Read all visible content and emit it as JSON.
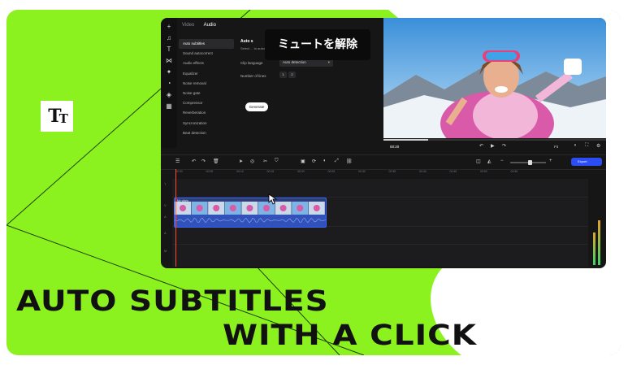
{
  "tooltip": {
    "text": "ミュートを解除"
  },
  "logo": {
    "big": "T",
    "small": "T"
  },
  "headline": {
    "line1": "AUTO SUBTITLES",
    "line2": "WITH A CLICK"
  },
  "colors": {
    "background": "#8cf21f",
    "app": "#161617",
    "accent": "#2b4df5",
    "clip": "#3a64ff",
    "playhead": "#ff4d2e"
  },
  "editor": {
    "tabs": [
      "Video",
      "Audio"
    ],
    "menu": [
      "Auto subtitles",
      "Sound autocorrect",
      "Audio effects",
      "Equalizer",
      "Noise removal",
      "Noise gate",
      "Compressor",
      "Reverberation",
      "Syncronization",
      "Beat detection"
    ],
    "panel": {
      "title": "Auto s",
      "description": "Select ... to automatically create subtitles",
      "clip_language_label": "Clip language",
      "clip_language_value": "Auto detection",
      "lines_label": "Number of lines",
      "lines_options": [
        "1",
        "2"
      ],
      "generate_label": "Generate"
    },
    "preview": {
      "timecode": "00:20",
      "zoom": "Fit"
    },
    "export_label": "Export",
    "ruler_ticks": [
      "00:00",
      "00:05",
      "00:10",
      "00:15",
      "00:20",
      "00:25",
      "00:30",
      "00:35",
      "00:40",
      "00:45",
      "00:50",
      "00:55"
    ],
    "track_labels": [
      "T",
      "V",
      "A",
      "A",
      "M"
    ],
    "clip_label": "My video",
    "playback_progress": 0.2
  }
}
